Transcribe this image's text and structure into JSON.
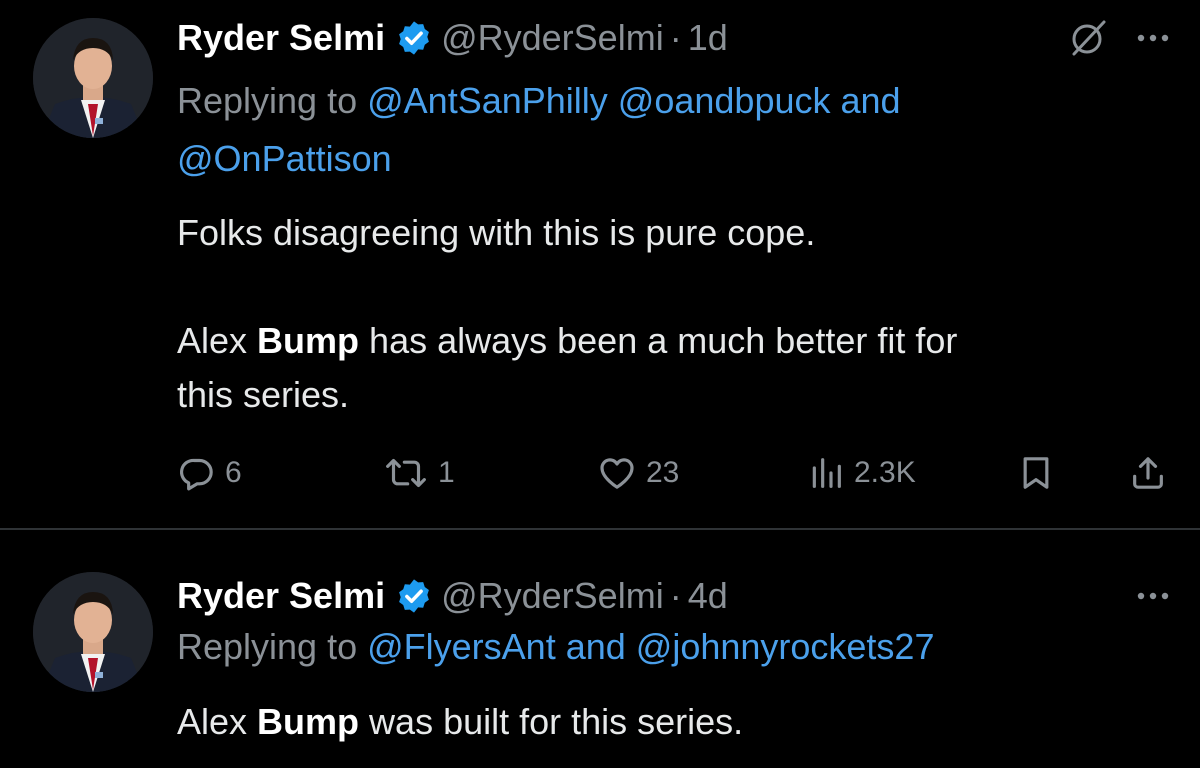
{
  "tweets": [
    {
      "name": "Ryder Selmi",
      "handle": "@RyderSelmi",
      "dot": "·",
      "time": "1d",
      "replying_prefix": "Replying to",
      "mentions_line1": "@AntSanPhilly @oandbpuck and",
      "mentions_line2": "@OnPattison",
      "para1": "Folks disagreeing with this is pure cope.",
      "para2_pre": "Alex ",
      "para2_bold": "Bump",
      "para2_post": " has always been a much better fit for",
      "para2_line2": "this series.",
      "actions": {
        "replies": "6",
        "reposts": "1",
        "likes": "23",
        "views": "2.3K"
      }
    },
    {
      "name": "Ryder Selmi",
      "handle": "@RyderSelmi",
      "dot": "·",
      "time": "4d",
      "replying_prefix": "Replying to",
      "mentions_line1": "@FlyersAnt and @johnnyrockets27",
      "body_pre": "Alex ",
      "body_bold": "Bump",
      "body_post": " was built for this series."
    }
  ],
  "icons": {
    "verified": "verified-badge-icon",
    "grok": "grok-icon",
    "more": "more-icon",
    "reply": "reply-icon",
    "repost": "repost-icon",
    "like": "heart-icon",
    "views": "views-icon",
    "bookmark": "bookmark-icon",
    "share": "share-icon"
  },
  "colors": {
    "background": "#000000",
    "text": "#e7e9ea",
    "secondary": "#8b9197",
    "link": "#4ba0eb",
    "verified": "#1d9bf0",
    "divider": "#2f3336"
  }
}
